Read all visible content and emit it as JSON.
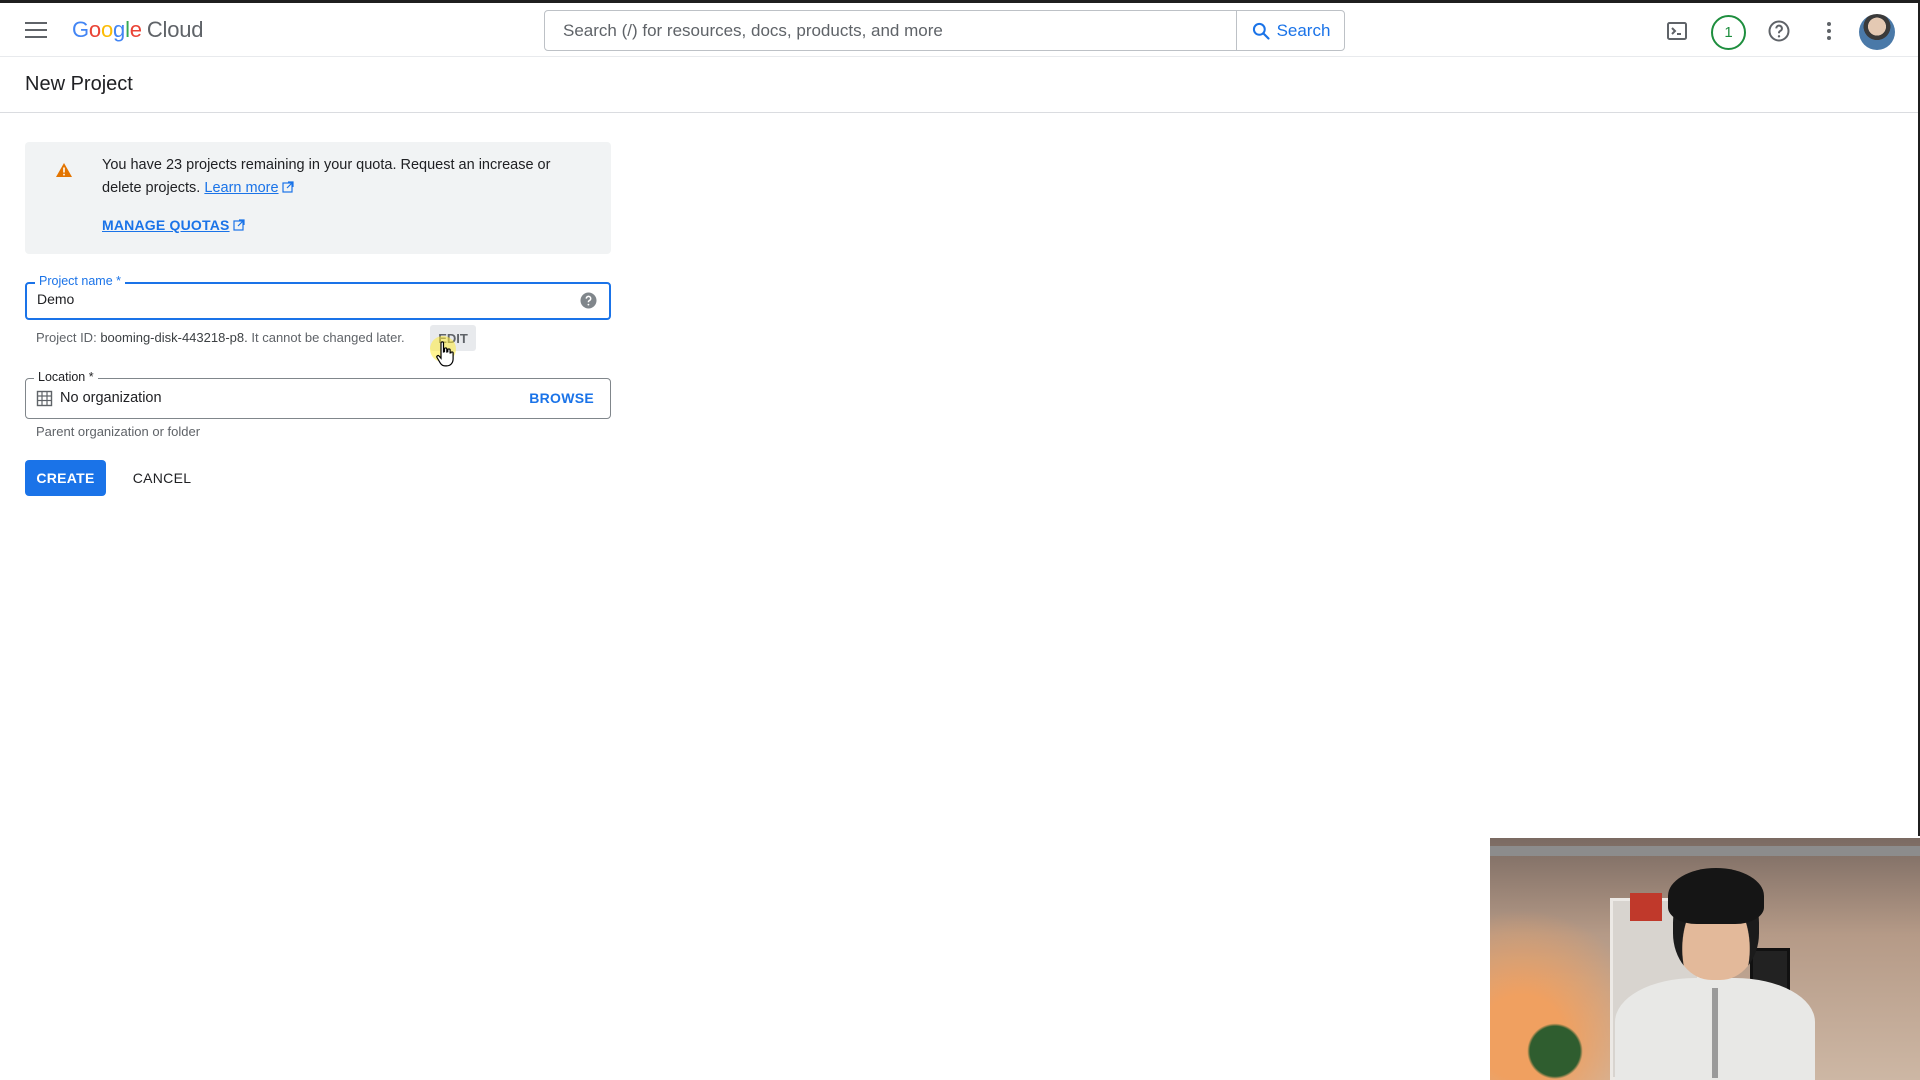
{
  "header": {
    "logo_letters": [
      "G",
      "o",
      "o",
      "g",
      "l",
      "e"
    ],
    "logo_cloud": "Cloud",
    "search_placeholder": "Search (/) for resources, docs, products, and more",
    "search_button": "Search",
    "notification_count": "1",
    "icons": [
      "hamburger-menu-icon",
      "search-icon",
      "cloud-shell-icon",
      "help-icon",
      "more-vert-icon",
      "avatar"
    ]
  },
  "page": {
    "title": "New Project"
  },
  "notice": {
    "text_main": "You have 23 projects remaining in your quota. Request an increase or delete projects.",
    "learn_more": "Learn more",
    "manage_quotas": "MANAGE QUOTAS",
    "icon": "warning-icon"
  },
  "form": {
    "project_name_label": "Project name *",
    "project_name_value": "Demo",
    "project_id_prefix": "Project ID:",
    "project_id": "booming-disk-443218-p8.",
    "project_id_suffix": "It cannot be changed later.",
    "edit_label": "EDIT",
    "location_label": "Location *",
    "location_value": "No organization",
    "browse_label": "BROWSE",
    "location_helper": "Parent organization or folder"
  },
  "actions": {
    "create": "CREATE",
    "cancel": "CANCEL"
  },
  "colors": {
    "accent": "#1a73e8",
    "warning": "#e37400",
    "badge": "#1e8e3e"
  }
}
